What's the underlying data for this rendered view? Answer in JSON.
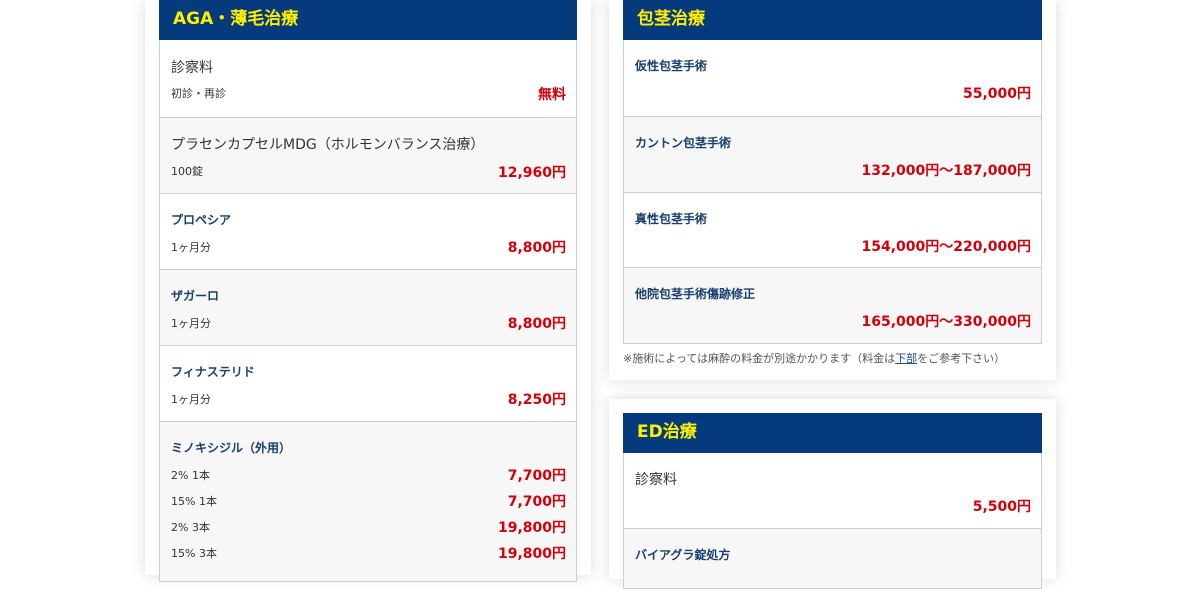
{
  "aga": {
    "header": "AGA・薄毛治療",
    "consult": {
      "title": "診察料",
      "sub": "初診・再診",
      "price": "無料"
    },
    "placen": {
      "title": "プラセンカプセルMDG（ホルモンバランス治療）",
      "sub": "100錠",
      "price": "12,960円"
    },
    "propecia": {
      "title": "プロペシア",
      "sub": "1ヶ月分",
      "price": "8,800円"
    },
    "zagallo": {
      "title": "ザガーロ",
      "sub": "1ヶ月分",
      "price": "8,800円"
    },
    "finasteride": {
      "title": "フィナステリド",
      "sub": "1ヶ月分",
      "price": "8,250円"
    },
    "minoxidil": {
      "title": "ミノキシジル（外用）",
      "items": [
        {
          "label": "2% 1本",
          "price": "7,700円"
        },
        {
          "label": "15% 1本",
          "price": "7,700円"
        },
        {
          "label": "2% 3本",
          "price": "19,800円"
        },
        {
          "label": "15% 3本",
          "price": "19,800円"
        }
      ]
    }
  },
  "phimosis": {
    "header": "包茎治療",
    "items": [
      {
        "title": "仮性包茎手術",
        "price": "55,000円"
      },
      {
        "title": "カントン包茎手術",
        "price": "132,000円〜187,000円"
      },
      {
        "title": "真性包茎手術",
        "price": "154,000円〜220,000円"
      },
      {
        "title": "他院包茎手術傷跡修正",
        "price": "165,000円〜330,000円"
      }
    ],
    "note_before": "※施術によっては麻酔の料金が別途かかります（料金は",
    "note_link": "下部",
    "note_after": "をご参考下さい）"
  },
  "ed": {
    "header": "ED治療",
    "consult": {
      "title": "診察料",
      "price": "5,500円"
    },
    "viagra": {
      "title": "バイアグラ錠処方"
    }
  },
  "colors": {
    "header_bg": "#053a7c",
    "header_text": "#fff000",
    "price": "#d3000b",
    "title_blue": "#183d70"
  }
}
